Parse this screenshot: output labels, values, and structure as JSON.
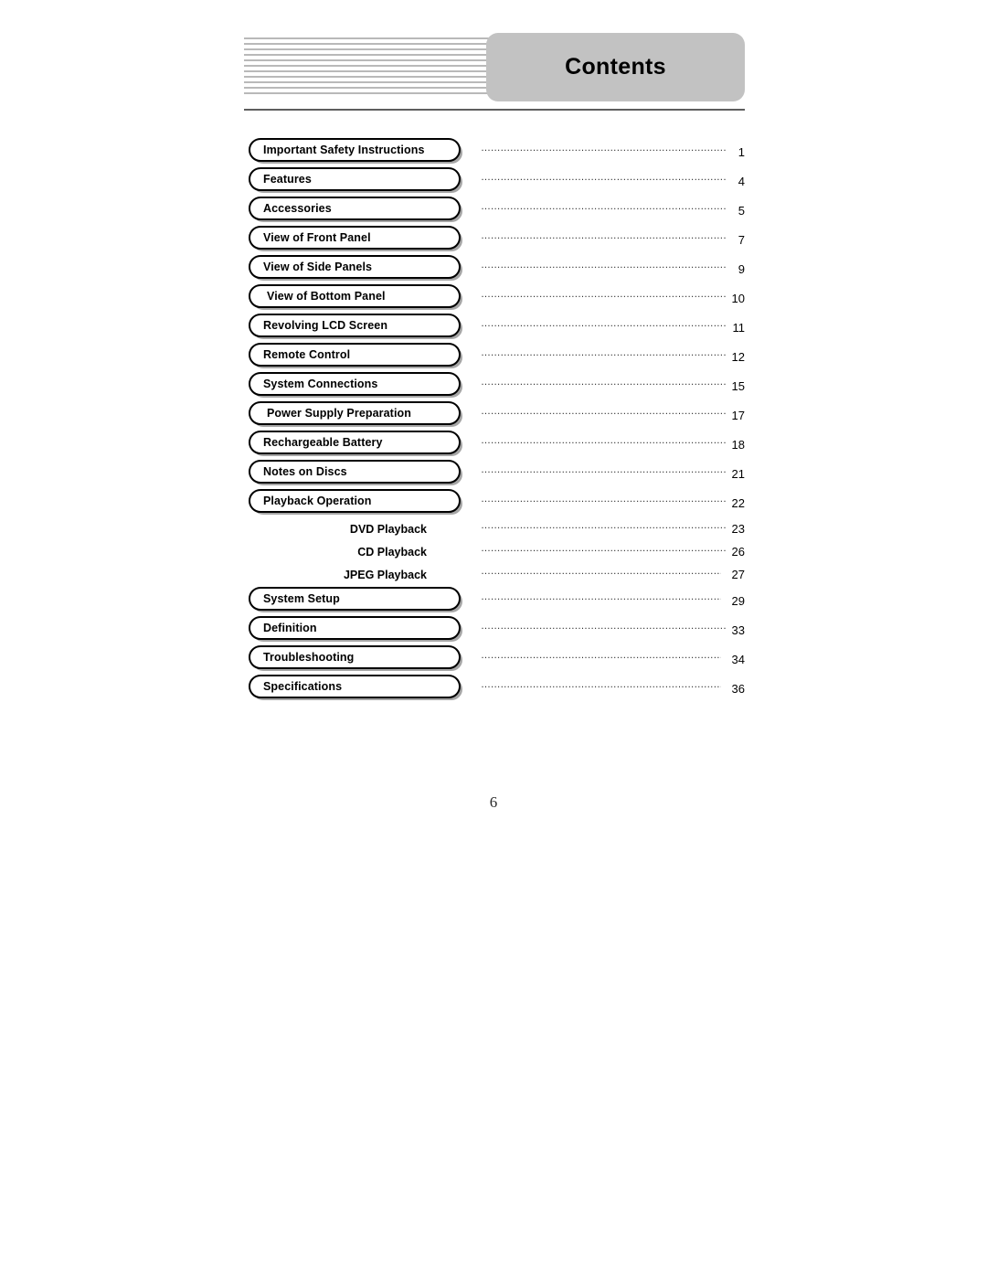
{
  "header": {
    "title": "Contents",
    "decoration_icon": "horizontal-stripes-decoration",
    "badge_color": "#c2c2c2",
    "rule_color": "#5e5e5e"
  },
  "toc": {
    "entries": [
      {
        "label": "Important Safety Instructions",
        "page": "1",
        "style": "boxed"
      },
      {
        "label": "Features",
        "page": "4",
        "style": "boxed"
      },
      {
        "label": "Accessories",
        "page": "5",
        "style": "boxed"
      },
      {
        "label": "View of Front Panel",
        "page": "7",
        "style": "boxed"
      },
      {
        "label": "View of Side Panels",
        "page": "9",
        "style": "boxed"
      },
      {
        "label": "View of Bottom Panel",
        "page": "10",
        "style": "boxed-indent"
      },
      {
        "label": "Revolving LCD Screen",
        "page": "11",
        "style": "boxed"
      },
      {
        "label": "Remote Control",
        "page": "12",
        "style": "boxed"
      },
      {
        "label": "System Connections",
        "page": "15",
        "style": "boxed"
      },
      {
        "label": "Power Supply Preparation",
        "page": "17",
        "style": "boxed-indent"
      },
      {
        "label": "Rechargeable Battery",
        "page": "18",
        "style": "boxed"
      },
      {
        "label": "Notes on Discs",
        "page": "21",
        "style": "boxed"
      },
      {
        "label": "Playback Operation",
        "page": "22",
        "style": "boxed"
      },
      {
        "label": "DVD Playback",
        "page": "23",
        "style": "sub"
      },
      {
        "label": "CD Playback",
        "page": "26",
        "style": "sub"
      },
      {
        "label": "JPEG Playback",
        "page": "27",
        "style": "sub-gap"
      },
      {
        "label": "System Setup",
        "page": "29",
        "style": "boxed-gap"
      },
      {
        "label": "Definition",
        "page": "33",
        "style": "boxed"
      },
      {
        "label": "Troubleshooting",
        "page": "34",
        "style": "boxed-gap"
      },
      {
        "label": "Specifications",
        "page": "36",
        "style": "boxed-gap"
      }
    ]
  },
  "footer": {
    "folio": "6"
  }
}
